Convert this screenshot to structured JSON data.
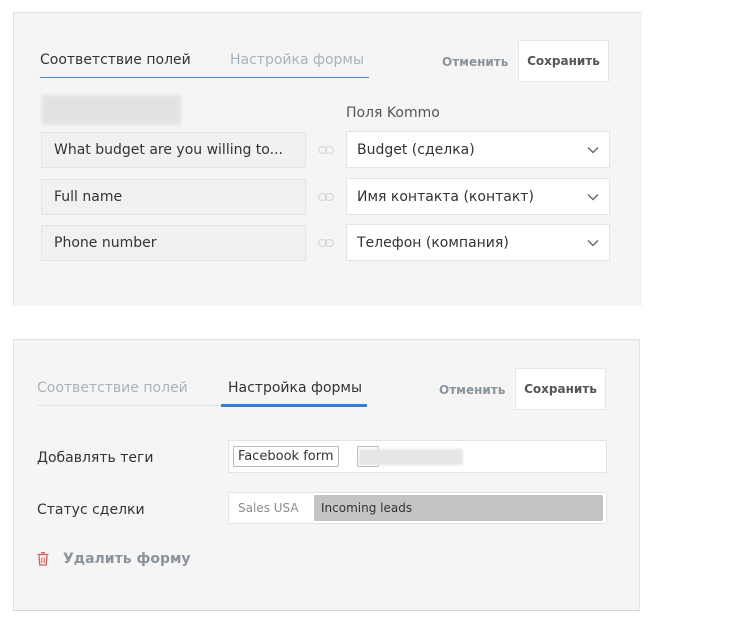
{
  "panel1": {
    "tabs": [
      {
        "label": "Соответствие полей",
        "active": true
      },
      {
        "label": "Настройка формы",
        "active": false
      }
    ],
    "cancel_label": "Отменить",
    "save_label": "Сохранить",
    "right_column_header": "Поля Kommo",
    "mappings": [
      {
        "form_field": "What budget are you willing to...",
        "crm_field": "Budget (сделка)"
      },
      {
        "form_field": "Full name",
        "crm_field": "Имя контакта (контакт)"
      },
      {
        "form_field": "Phone number",
        "crm_field": "Телефон (компания)"
      }
    ],
    "icons": {
      "link": "link-icon",
      "dropdown": "chevron-down-icon"
    }
  },
  "panel2": {
    "tabs": [
      {
        "label": "Соответствие полей",
        "active": false
      },
      {
        "label": "Настройка формы",
        "active": true
      }
    ],
    "cancel_label": "Отменить",
    "save_label": "Сохранить",
    "tags_label": "Добавлять теги",
    "tags": [
      "Facebook form"
    ],
    "deal_status_label": "Статус сделки",
    "status_pipeline": "Sales USA",
    "status_stage": "Incoming leads",
    "delete_label": "Удалить форму",
    "icons": {
      "delete": "trash-icon"
    }
  },
  "colors": {
    "accent": "#3a7bd5",
    "panel_bg": "#f5f5f5",
    "delete_icon": "#e0575b",
    "stage_bg": "#c4c4c4"
  }
}
